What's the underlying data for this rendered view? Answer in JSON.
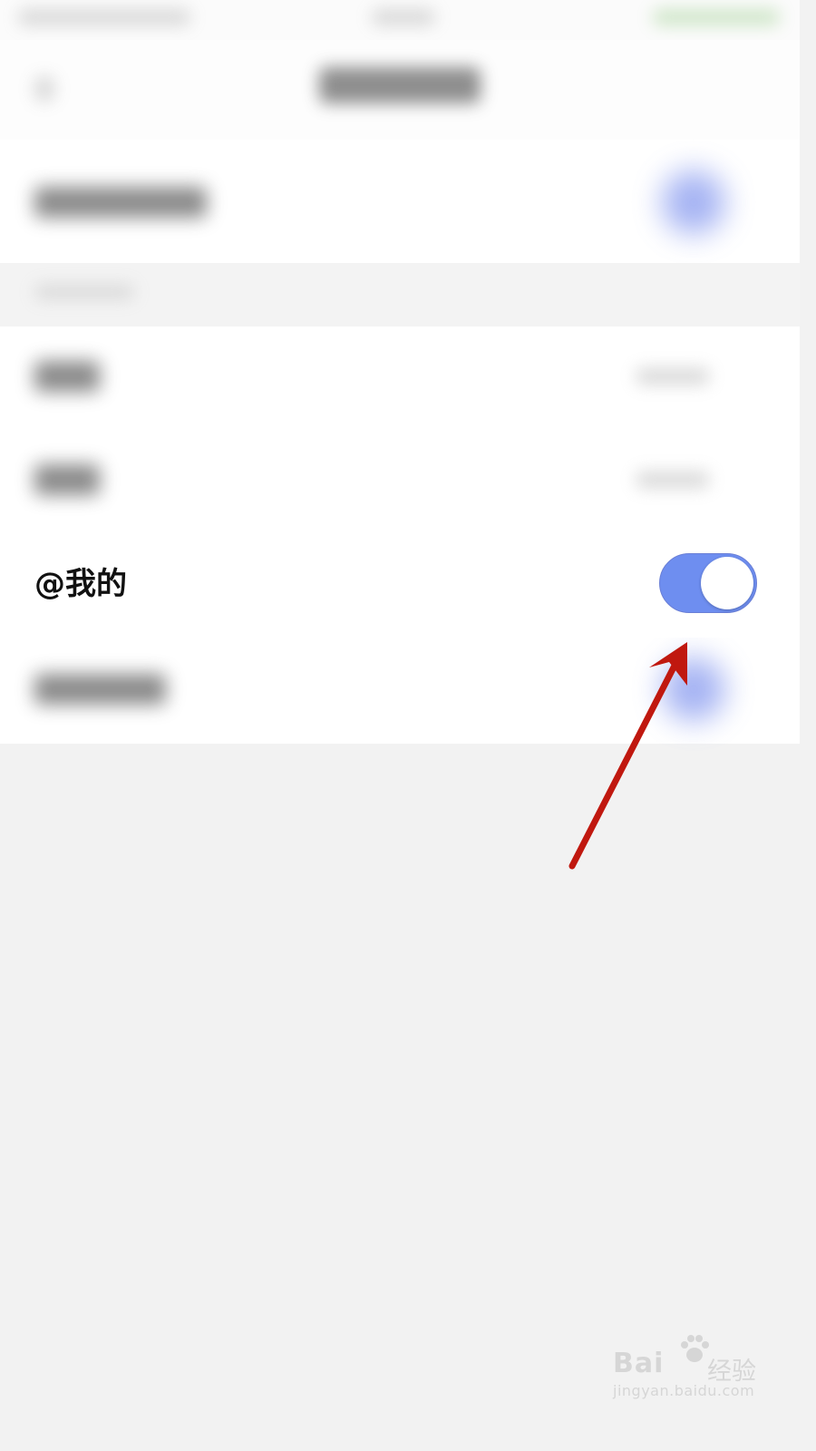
{
  "settings": {
    "focused_row": {
      "label": "@我的",
      "toggle_state": "on"
    }
  },
  "watermark": {
    "brand": "Bai",
    "brand_suffix": "经验",
    "url": "jingyan.baidu.com"
  },
  "colors": {
    "toggle_on": "#6e8ef0",
    "arrow": "#c0180f",
    "background": "#f2f2f2"
  },
  "icons": {
    "annotation_arrow": "arrow-annotation-icon",
    "watermark_paw": "paw-icon"
  }
}
